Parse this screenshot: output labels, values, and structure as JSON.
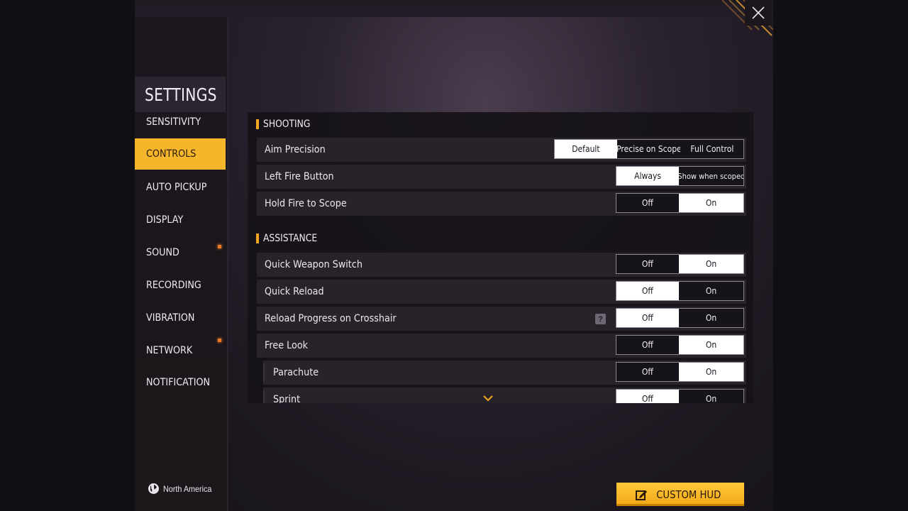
{
  "sidebar": {
    "title": "SETTINGS",
    "items": [
      {
        "label": "SENSITIVITY"
      },
      {
        "label": "CONTROLS"
      },
      {
        "label": "AUTO PICKUP"
      },
      {
        "label": "DISPLAY"
      },
      {
        "label": "SOUND"
      },
      {
        "label": "RECORDING"
      },
      {
        "label": "VIBRATION"
      },
      {
        "label": "NETWORK"
      },
      {
        "label": "NOTIFICATION"
      }
    ],
    "active_item": "CONTROLS",
    "region": "North America",
    "notification_dot_color": "#f07a28"
  },
  "sections": {
    "shooting": {
      "title": "SHOOTING",
      "rows": {
        "aim_precision": {
          "label": "Aim Precision",
          "options": [
            "Default",
            "Precise on Scope",
            "Full Control"
          ],
          "selected": "Default"
        },
        "left_fire_button": {
          "label": "Left Fire Button",
          "options": [
            "Always",
            "Show when scoped"
          ],
          "selected": "Always"
        },
        "hold_fire_to_scope": {
          "label": "Hold Fire to Scope",
          "options": [
            "Off",
            "On"
          ],
          "selected": "On"
        }
      }
    },
    "assistance": {
      "title": "ASSISTANCE",
      "rows": {
        "quick_weapon_switch": {
          "label": "Quick Weapon Switch",
          "options": [
            "Off",
            "On"
          ],
          "selected": "On"
        },
        "quick_reload": {
          "label": "Quick Reload",
          "options": [
            "Off",
            "On"
          ],
          "selected": "Off"
        },
        "reload_progress": {
          "label": "Reload Progress on Crosshair",
          "options": [
            "Off",
            "On"
          ],
          "selected": "Off",
          "help": "?"
        },
        "free_look": {
          "label": "Free Look",
          "options": [
            "Off",
            "On"
          ],
          "selected": "On"
        },
        "parachute": {
          "label": "Parachute",
          "options": [
            "Off",
            "On"
          ],
          "selected": "On"
        },
        "sprint": {
          "label": "Sprint",
          "options": [
            "Off",
            "On"
          ],
          "selected": "Off"
        }
      }
    }
  },
  "custom_hud_label": "CUSTOM HUD",
  "colors": {
    "accent": "#f5b62c",
    "section_marker": "#f5a623",
    "selected_option": "#ffffff"
  },
  "icons": {
    "close": "close-icon",
    "globe": "globe-icon",
    "edit": "edit-icon",
    "help": "help-icon",
    "chevron": "chevron-down-icon"
  }
}
